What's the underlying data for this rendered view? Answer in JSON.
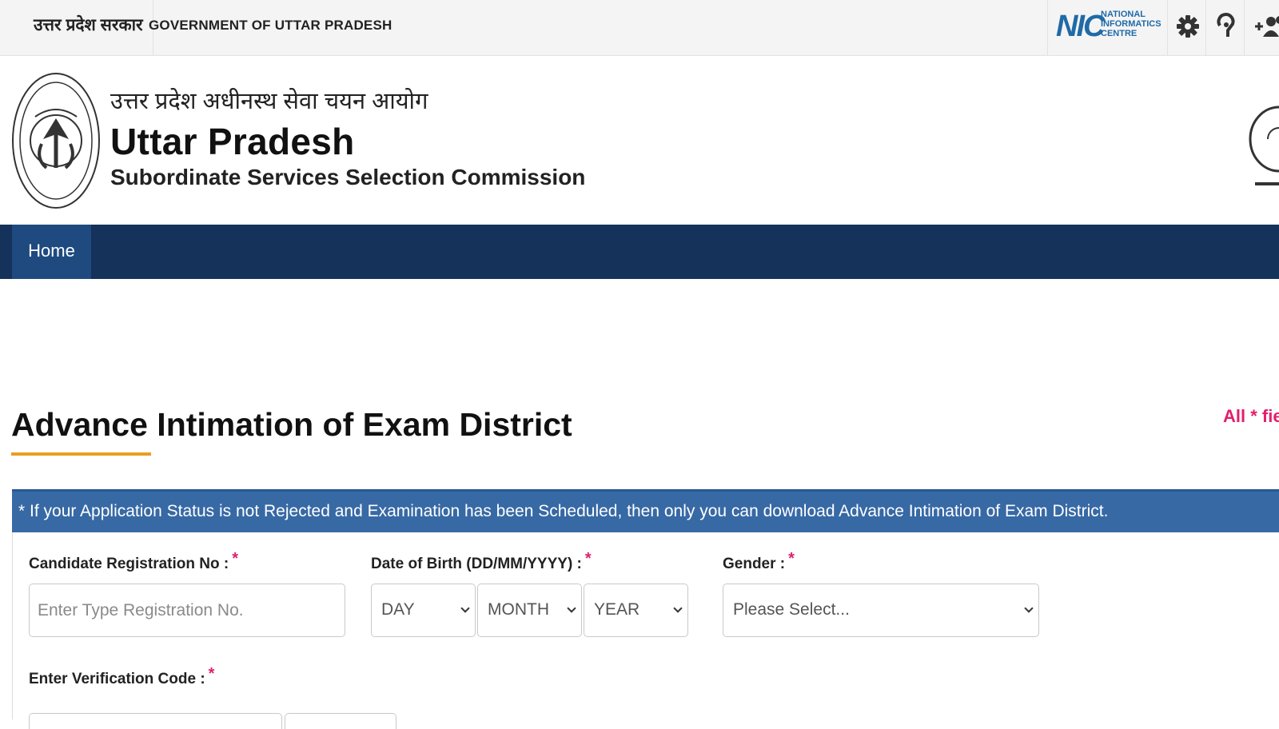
{
  "topbar": {
    "gov_hindi": "उत्तर प्रदेश सरकार",
    "gov_english": "GOVERNMENT OF UTTAR PRADESH",
    "nic_logo_text": "NIC",
    "nic_name_lines": [
      "NATIONAL",
      "INFORMATICS",
      "CENTRE"
    ],
    "icons": [
      "gear-icon",
      "accessibility-icon",
      "user-add-icon"
    ]
  },
  "header": {
    "title_hindi": "उत्तर प्रदेश अधीनस्थ सेवा चयन आयोग",
    "title_main": "Uttar Pradesh",
    "title_sub": "Subordinate Services Selection Commission"
  },
  "nav": {
    "items": [
      {
        "label": "Home",
        "active": true
      }
    ]
  },
  "main": {
    "page_title": "Advance Intimation of Exam District",
    "mandatory_note": "All * field",
    "info_banner": "* If your Application Status is not Rejected and Examination has been Scheduled, then only you can download Advance Intimation of Exam District."
  },
  "form": {
    "registration": {
      "label": "Candidate Registration No :",
      "required": "*",
      "placeholder": "Enter Type Registration No.",
      "value": ""
    },
    "dob": {
      "label": "Date of Birth (DD/MM/YYYY) :",
      "required": "*",
      "day": "DAY",
      "month": "MONTH",
      "year": "YEAR"
    },
    "gender": {
      "label": "Gender :",
      "required": "*",
      "selected": "Please Select..."
    },
    "verification": {
      "label": "Enter Verification Code :",
      "required": "*"
    }
  },
  "colors": {
    "nav_bg": "#14325a",
    "nav_active": "#1e4a80",
    "banner_bg": "#3769a5",
    "accent_underline": "#e8a020",
    "required_mark": "#e0206c"
  }
}
